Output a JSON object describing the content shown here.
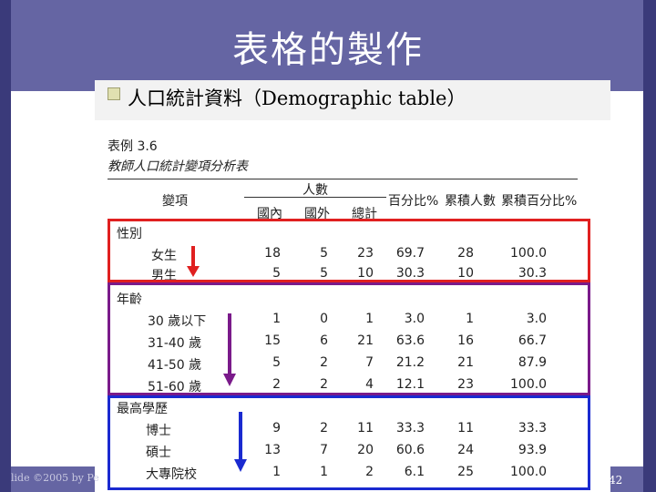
{
  "slide": {
    "title": "表格的製作",
    "bullet_text": "人口統計資料（Demographic table）",
    "footer_left": "lide ©2005 by Pe",
    "page_number": "42"
  },
  "table": {
    "caption_no": "表例 3.6",
    "caption": "教師人口統計變項分析表",
    "header_group": "人數",
    "headers": [
      "變項",
      "國內",
      "國外",
      "總計",
      "百分比%",
      "累積人數",
      "累積百分比%"
    ],
    "groups": [
      {
        "name": "性別",
        "color": "#e02020",
        "rows": [
          {
            "label": "女生",
            "values": [
              "18",
              "5",
              "23",
              "69.7",
              "28",
              "100.0"
            ]
          },
          {
            "label": "男生",
            "values": [
              "5",
              "5",
              "10",
              "30.3",
              "10",
              "30.3"
            ]
          }
        ]
      },
      {
        "name": "年齡",
        "color": "#7a1a8a",
        "rows": [
          {
            "label": "30 歲以下",
            "values": [
              "1",
              "0",
              "1",
              "3.0",
              "1",
              "3.0"
            ]
          },
          {
            "label": "31-40 歲",
            "values": [
              "15",
              "6",
              "21",
              "63.6",
              "16",
              "66.7"
            ]
          },
          {
            "label": "41-50 歲",
            "values": [
              "5",
              "2",
              "7",
              "21.2",
              "21",
              "87.9"
            ]
          },
          {
            "label": "51-60 歲",
            "values": [
              "2",
              "2",
              "4",
              "12.1",
              "23",
              "100.0"
            ]
          }
        ]
      },
      {
        "name": "最高學歷",
        "color": "#1a2ad0",
        "rows": [
          {
            "label": "博士",
            "values": [
              "9",
              "2",
              "11",
              "33.3",
              "11",
              "33.3"
            ]
          },
          {
            "label": "碩士",
            "values": [
              "13",
              "7",
              "20",
              "60.6",
              "24",
              "93.9"
            ]
          },
          {
            "label": "大專院校",
            "values": [
              "1",
              "1",
              "2",
              "6.1",
              "25",
              "100.0"
            ]
          }
        ]
      }
    ]
  }
}
